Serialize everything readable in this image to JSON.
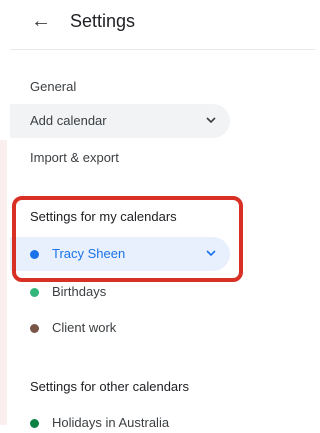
{
  "header": {
    "back_icon": "arrow-left-icon",
    "title": "Settings"
  },
  "nav": {
    "general": "General",
    "add_calendar": "Add calendar",
    "import_export": "Import & export"
  },
  "my_calendars": {
    "title": "Settings for my calendars",
    "items": [
      {
        "label": "Tracy Sheen",
        "color": "#1a73e8",
        "selected": true
      },
      {
        "label": "Birthdays",
        "color": "#33b679",
        "selected": false
      },
      {
        "label": "Client work",
        "color": "#795548",
        "selected": false
      }
    ]
  },
  "other_calendars": {
    "title": "Settings for other calendars",
    "items": [
      {
        "label": "Holidays in Australia",
        "color": "#0b8043"
      }
    ]
  },
  "colors": {
    "accent": "#1a73e8",
    "highlight_border": "#d93025",
    "selected_bg": "#e8f0fe",
    "dropdown_bg": "#f1f3f4"
  }
}
